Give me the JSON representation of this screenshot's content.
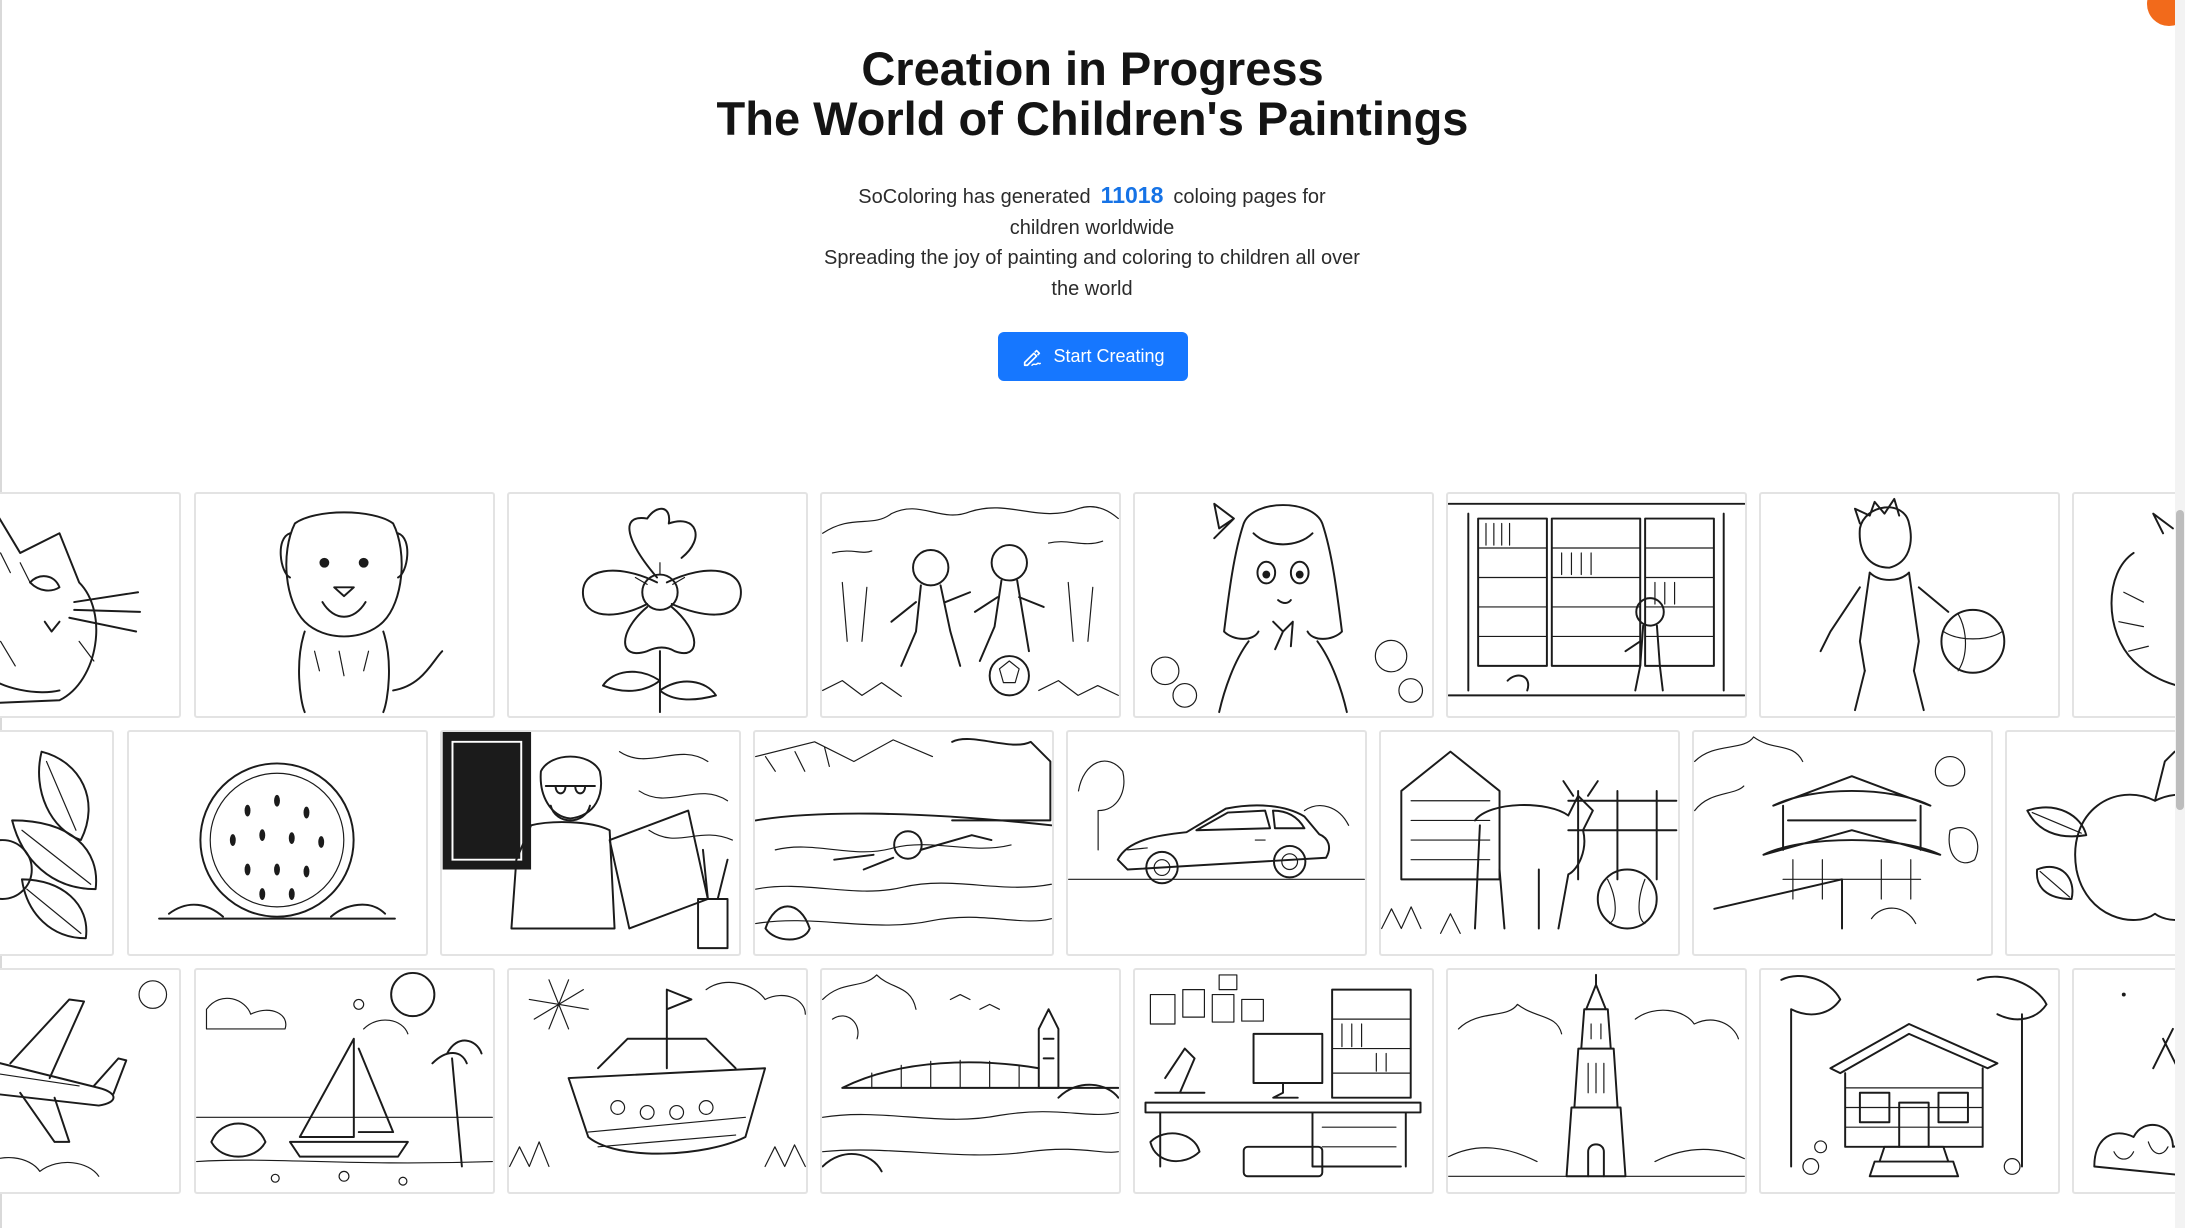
{
  "hero": {
    "title_line1": "Creation in Progress",
    "title_line2": "The World of Children's Paintings",
    "subtitle_prefix": "SoColoring has generated",
    "page_count": "11018",
    "subtitle_suffix": "coloing pages for children worldwide",
    "subtitle_line2": "Spreading the joy of painting and coloring to children all over the world",
    "cta_label": "Start Creating",
    "cta_icon": "pen-signature-icon"
  },
  "gallery": {
    "rows": [
      [
        "cat",
        "dog",
        "flower",
        "kids-playing-soccer",
        "anime-girl",
        "library-boy",
        "boy-with-ball",
        "cat-partial"
      ],
      [
        "leaves",
        "watermelon",
        "man-with-laptop",
        "swimming-boy",
        "car",
        "cow-on-farm",
        "chinese-pavilion",
        "apple"
      ],
      [
        "airplane",
        "sailboat-beach",
        "shipwreck-boat",
        "bridge-over-river",
        "desk-workspace",
        "tower-landscape",
        "house-in-forest",
        "plant-partial"
      ]
    ]
  },
  "colors": {
    "accent": "#1677ff",
    "count_color": "#1673e6",
    "corner_badge": "#f26a1b"
  }
}
